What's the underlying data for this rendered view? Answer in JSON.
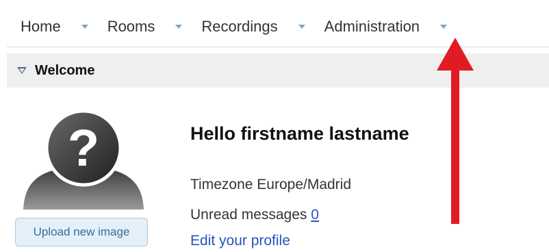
{
  "menu": {
    "items": [
      {
        "label": "Home"
      },
      {
        "label": "Rooms"
      },
      {
        "label": "Recordings"
      },
      {
        "label": "Administration"
      }
    ]
  },
  "welcome": {
    "title": "Welcome"
  },
  "profile": {
    "upload_label": "Upload new image",
    "greeting": "Hello firstname lastname",
    "timezone_label": "Timezone",
    "timezone_value": "Europe/Madrid",
    "unread_label": "Unread messages",
    "unread_count": "0",
    "edit_profile_label": "Edit your profile"
  },
  "colors": {
    "accent_link": "#2a52be",
    "annotation_arrow": "#e01b24",
    "menu_caret": "#7aa6c8"
  },
  "icons": {
    "avatar": "unknown-user-question-mark-icon",
    "annotation": "red-arrow-up"
  }
}
